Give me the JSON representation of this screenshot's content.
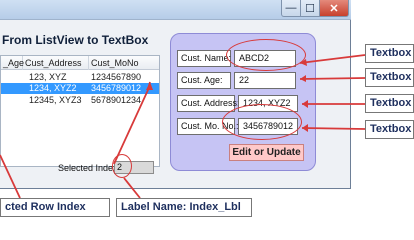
{
  "window": {
    "minimize_glyph": "—",
    "maximize_glyph": "☐",
    "close_glyph": "✕"
  },
  "form_title": "From ListView to TextBox",
  "listview": {
    "columns": [
      "_Age",
      "Cust_Address",
      "Cust_MoNo"
    ],
    "rows": [
      {
        "age": "",
        "address": "123, XYZ",
        "mobile": "1234567890"
      },
      {
        "age": "",
        "address": "1234, XYZ2",
        "mobile": "3456789012",
        "selected": true
      },
      {
        "age": "",
        "address": "12345, XYZ3",
        "mobile": "5678901234"
      }
    ]
  },
  "selected_index": {
    "label": "Selected Index",
    "value": "2"
  },
  "fields": {
    "name": {
      "label": "Cust. Name:",
      "value": "ABCD2"
    },
    "age": {
      "label": "Cust. Age:",
      "value": "22"
    },
    "address": {
      "label": "Cust. Address:",
      "value": "1234, XYZ2"
    },
    "mobile": {
      "label": "Cust. Mo. No.:",
      "value": "3456789012"
    }
  },
  "edit_button_label": "Edit or Update",
  "annotations": {
    "textbox_1": "Textbox N",
    "textbox_2": "Textbox N",
    "textbox_3": "Textbox N",
    "textbox_4": "Textbox N",
    "selected_row": "cted Row Index",
    "index_label": "Label Name: Index_Lbl"
  },
  "colors": {
    "annotation_red": "#d83a3a",
    "selection_blue": "#3399ff",
    "panel_lavender": "#c6c4f4",
    "button_pink": "#ffc9c9"
  }
}
